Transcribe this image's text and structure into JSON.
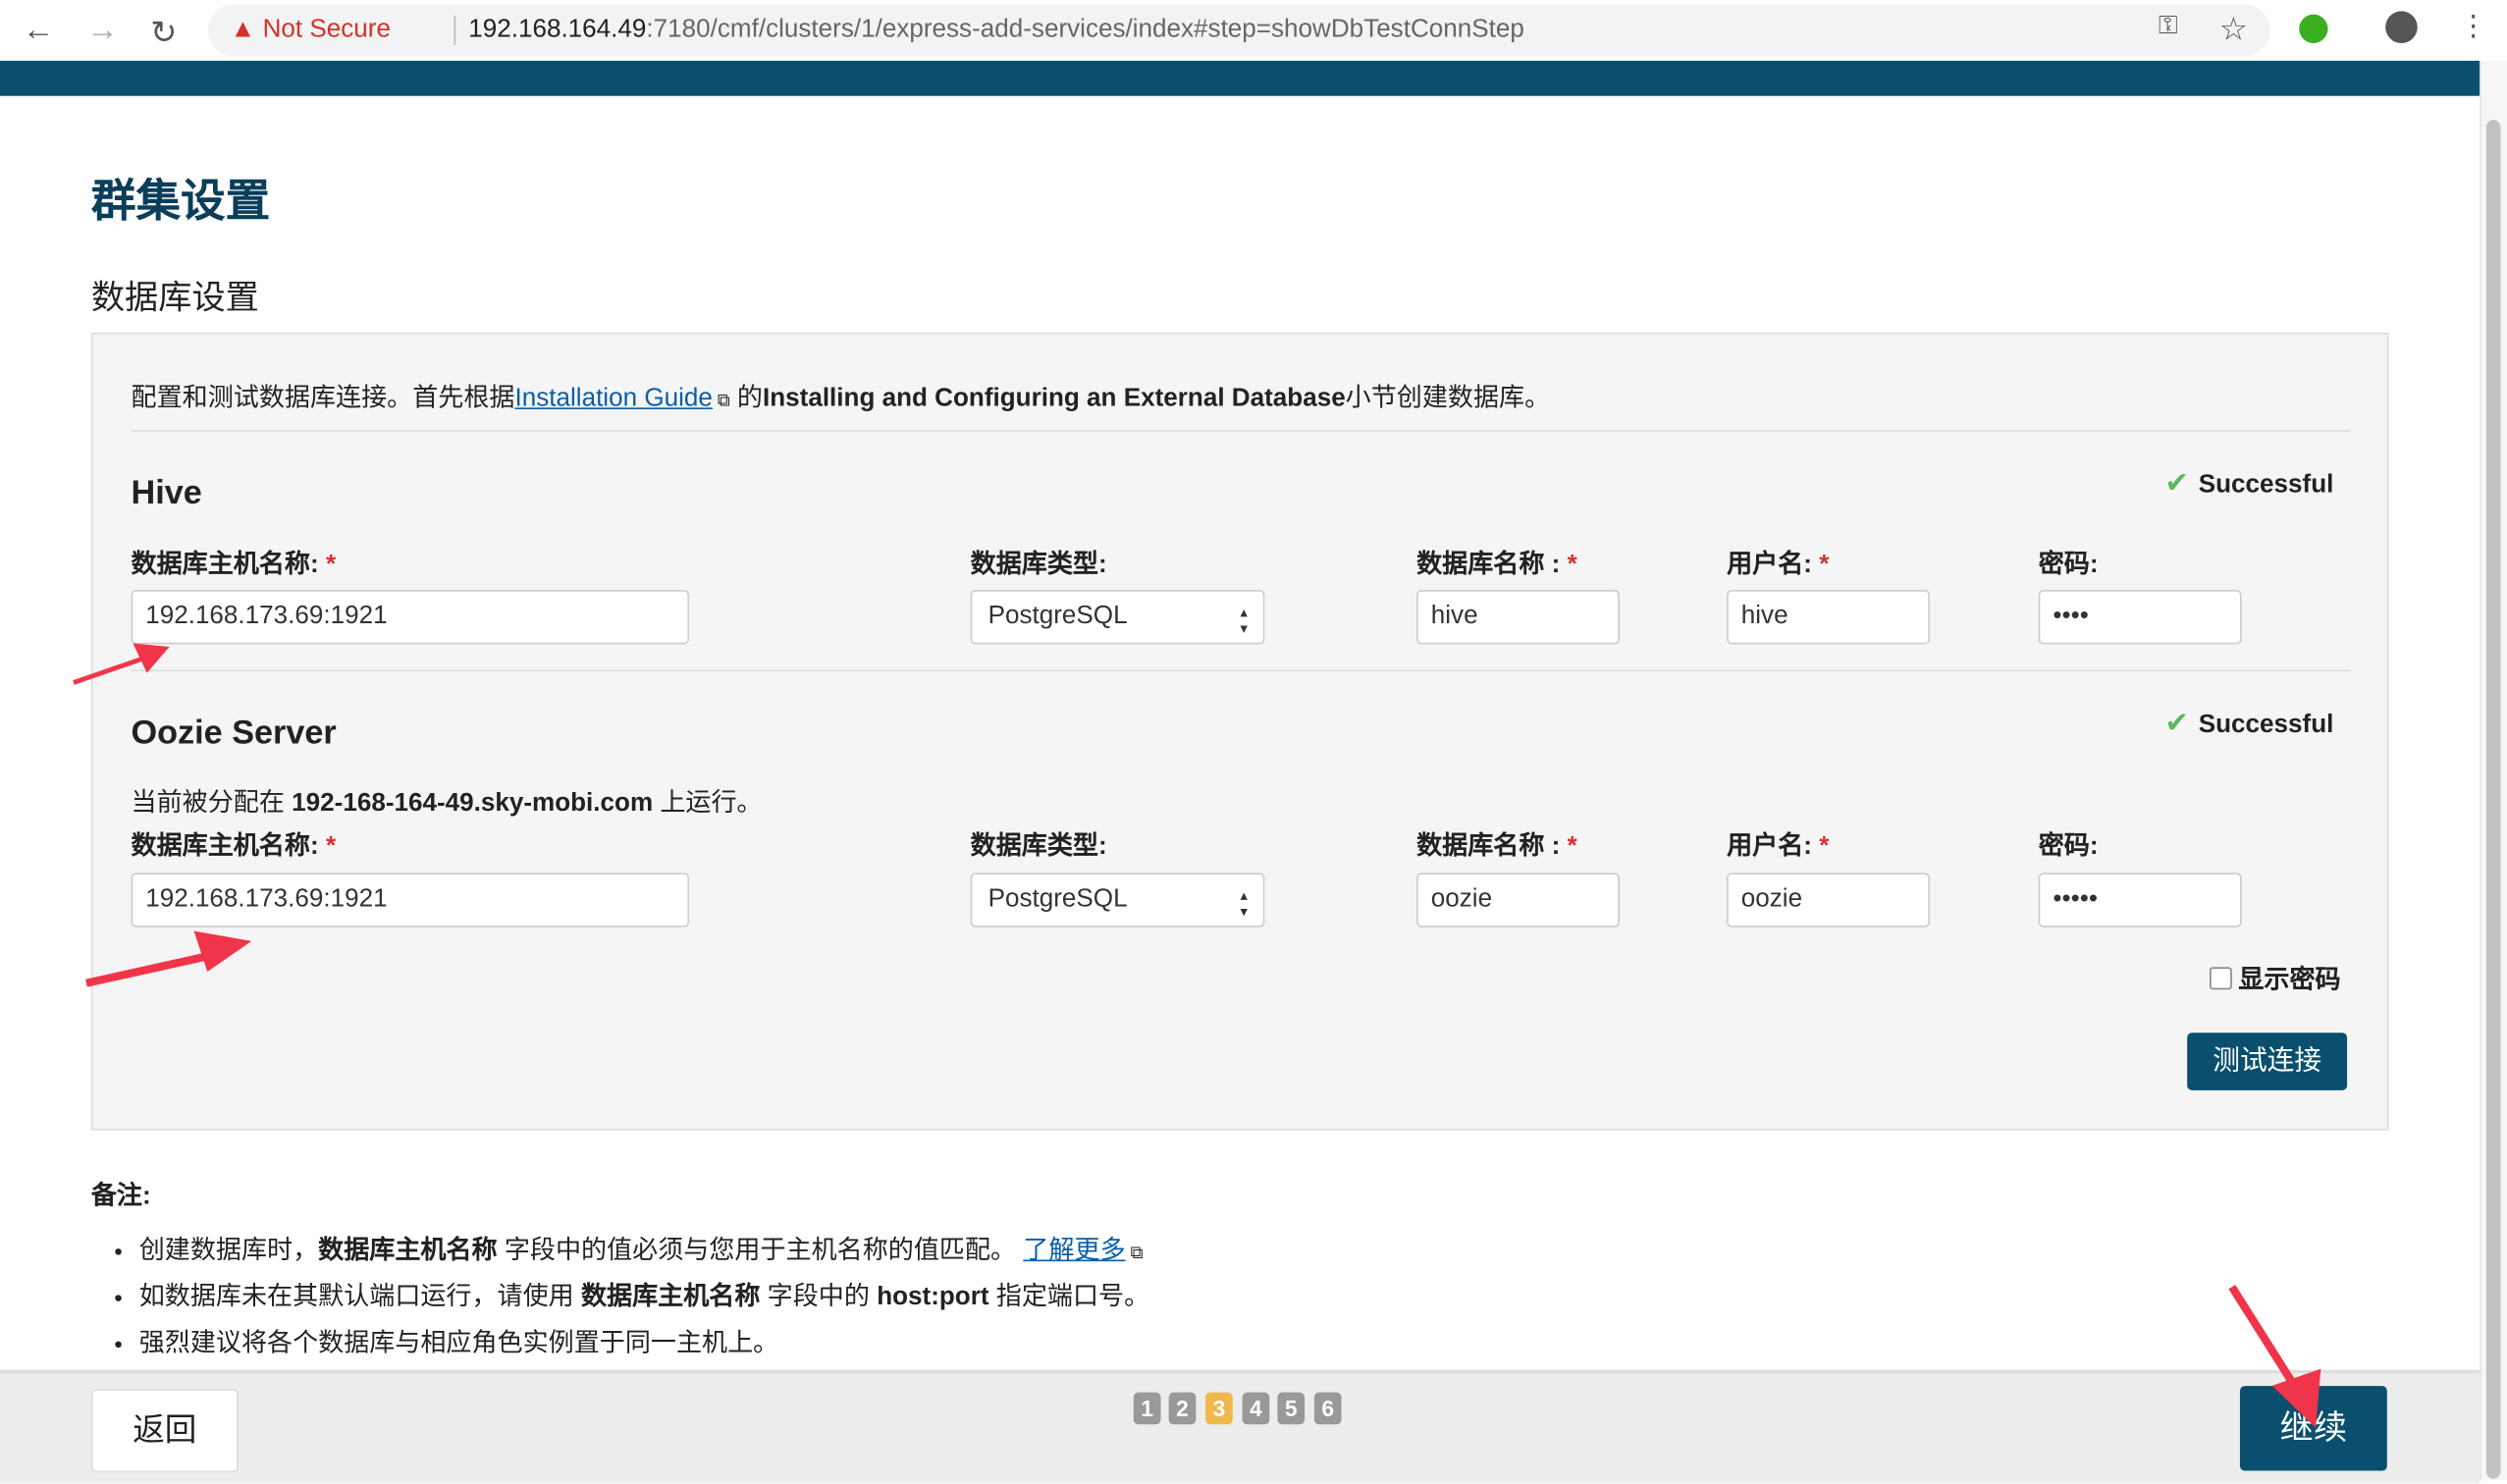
{
  "browser": {
    "security_label": "Not Secure",
    "url_host": "192.168.164.49",
    "url_rest": ":7180/cmf/clusters/1/express-add-services/index#step=showDbTestConnStep"
  },
  "page": {
    "title": "群集设置",
    "subtitle": "数据库设置"
  },
  "intro": {
    "prefix": "配置和测试数据库连接。首先根据",
    "link": "Installation Guide",
    "middle": " 的",
    "bold": "Installing and Configuring an External Database",
    "suffix": "小节创建数据库。"
  },
  "labels": {
    "host": "数据库主机名称:",
    "type": "数据库类型:",
    "dbname": "数据库名称 :",
    "user": "用户名:",
    "password": "密码:",
    "required": "*"
  },
  "hive": {
    "title": "Hive",
    "status": "Successful",
    "host": "192.168.173.69:1921",
    "type": "PostgreSQL",
    "dbname": "hive",
    "user": "hive",
    "password": "••••"
  },
  "oozie": {
    "title": "Oozie Server",
    "status": "Successful",
    "assigned_prefix": "当前被分配在 ",
    "assigned_host": "192-168-164-49.sky-mobi.com",
    "assigned_suffix": " 上运行。",
    "host": "192.168.173.69:1921",
    "type": "PostgreSQL",
    "dbname": "oozie",
    "user": "oozie",
    "password": "•••••"
  },
  "show_password": "显示密码",
  "test_button": "测试连接",
  "notes": {
    "title": "备注:",
    "n1a": "创建数据库时，",
    "n1b": "数据库主机名称",
    "n1c": " 字段中的值必须与您用于主机名称的值匹配。 ",
    "n1link": "了解更多",
    "n2a": "如数据库未在其默认端口运行，请使用 ",
    "n2b": "数据库主机名称",
    "n2c": " 字段中的 ",
    "n2d": "host:port",
    "n2e": " 指定端口号。",
    "n3": "强烈建议将各个数据库与相应角色实例置于同一主机上。"
  },
  "footer": {
    "back": "返回",
    "continue": "继续",
    "steps": [
      "1",
      "2",
      "3",
      "4",
      "5",
      "6"
    ],
    "current_step": "3"
  },
  "colors": {
    "brand": "#0a4f6e",
    "active_step": "#f0b84c",
    "annotation_arrow": "#f0354a"
  }
}
